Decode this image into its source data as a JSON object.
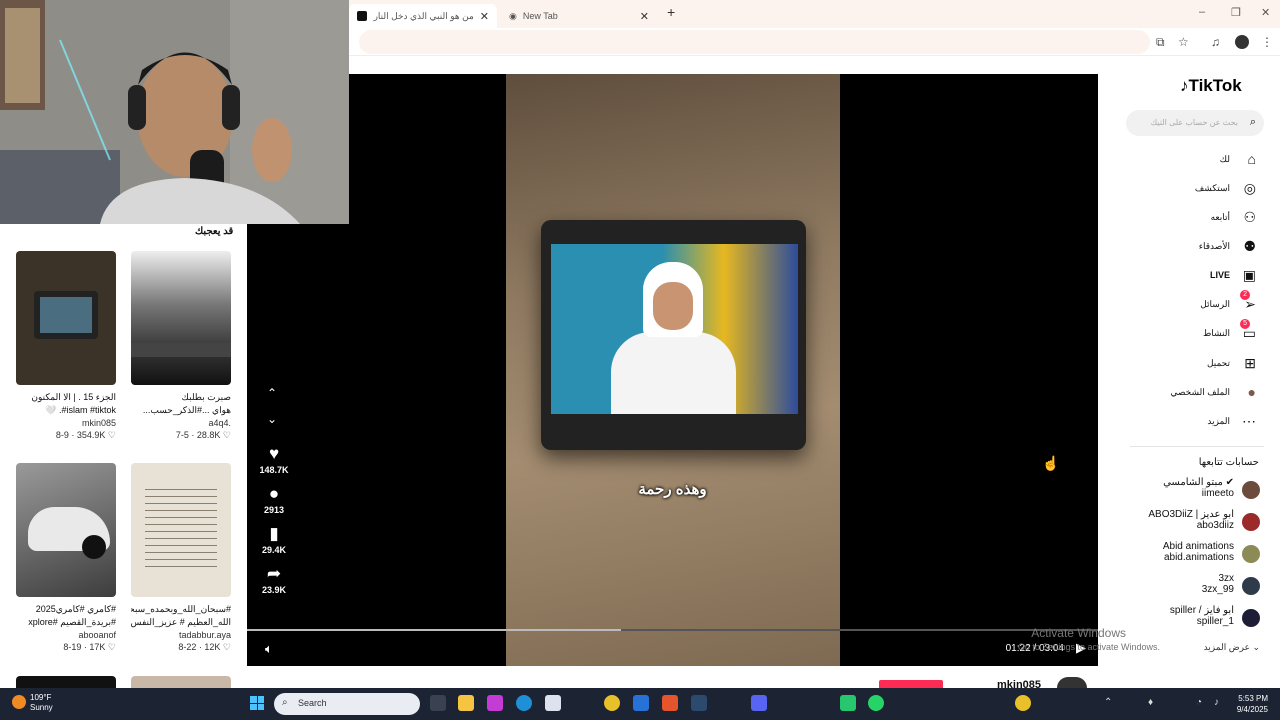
{
  "browser": {
    "tabs": [
      {
        "label": "من هو النبي الذي دخل النار في ال",
        "close": "✕"
      },
      {
        "label": "New Tab",
        "close": "✕"
      }
    ],
    "new_tab": "+",
    "window_controls": [
      "–",
      "❐",
      "✕"
    ]
  },
  "recommended": {
    "title": "قد يعجبك",
    "cards": [
      {
        "caption": "الجزء 15 . | الا المكنون",
        "caption2": "islam #tiktok#. 🤍",
        "author": "mkin085",
        "date": "8-9",
        "likes": "354.9K",
        "thumb_color": "#3b3328"
      },
      {
        "caption": "صبرت بطلبك",
        "caption2": "هواي ...#الذكر_حسب...",
        "author": "a4q4.",
        "date": "7-5",
        "likes": "28.8K",
        "thumb_color": "#8a8a8a"
      },
      {
        "caption": "#كامري #كامري2025",
        "caption2": "#بريدة_القصيم #xplore",
        "author": "abooanof",
        "date": "8-19",
        "likes": "17K",
        "thumb_color": "#6d6d6d"
      },
      {
        "caption": "#سبحان_الله_وبحمده_سبحان",
        "caption2": "الله_العظيم # عزيز_النفس...",
        "author": "tadabbur.aya",
        "date": "8-22",
        "likes": "12K",
        "thumb_color": "#e8e2d6"
      }
    ]
  },
  "player": {
    "subtitle": "وهذه رحمة",
    "likes": "148.7K",
    "comments": "2913",
    "saves": "29.4K",
    "shares": "23.9K",
    "time": "01:22 / 03:04",
    "progress_fraction": 0.44,
    "watermark_title": "Activate Windows",
    "watermark_text": "Go to Settings to activate Windows."
  },
  "sidebar": {
    "logo": "TikTok",
    "search_placeholder": "بحث عن حساب على التيك",
    "nav": [
      {
        "label": "لك",
        "icon": "home-icon",
        "glyph": "⌂"
      },
      {
        "label": "استكشف",
        "icon": "compass-icon",
        "glyph": "◎"
      },
      {
        "label": "أتابعه",
        "icon": "following-icon",
        "glyph": "⚇"
      },
      {
        "label": "الأصدقاء",
        "icon": "friends-icon",
        "glyph": "⚉"
      },
      {
        "label": "LIVE",
        "icon": "live-icon",
        "glyph": "▣"
      },
      {
        "label": "الرسائل",
        "icon": "messages-icon",
        "glyph": "➢",
        "badge": "2"
      },
      {
        "label": "النشاط",
        "icon": "activity-icon",
        "glyph": "▭",
        "badge": "5"
      },
      {
        "label": "تحميل",
        "icon": "upload-icon",
        "glyph": "⊞"
      },
      {
        "label": "الملف الشخصي",
        "icon": "profile-icon",
        "glyph": "●"
      },
      {
        "label": "المزيد",
        "icon": "more-icon",
        "glyph": "⋯"
      }
    ],
    "following_title": "حسابات تتابعها",
    "accounts": [
      {
        "name": "مبتو الشامسي ✔",
        "handle": "iimeeto",
        "color": "#6c4a3c"
      },
      {
        "name": "ABO3DiiZ | ابو عديز",
        "handle": "abo3diiz",
        "color": "#9b2a2a"
      },
      {
        "name": "Abid animations",
        "handle": "abid.animations",
        "color": "#8c8a55"
      },
      {
        "name": "3zx",
        "handle": "3zx_99",
        "color": "#2f3b4a"
      },
      {
        "name": "spiller / ابو فايز",
        "handle": "spiller_1",
        "color": "#1d1d35"
      }
    ],
    "see_more": "عرض المزيد"
  },
  "bottom": {
    "username": "mkin085"
  },
  "taskbar": {
    "temp": "109°F",
    "condition": "Sunny",
    "search": "Search",
    "time": "5:53 PM",
    "date": "9/4/2025"
  }
}
